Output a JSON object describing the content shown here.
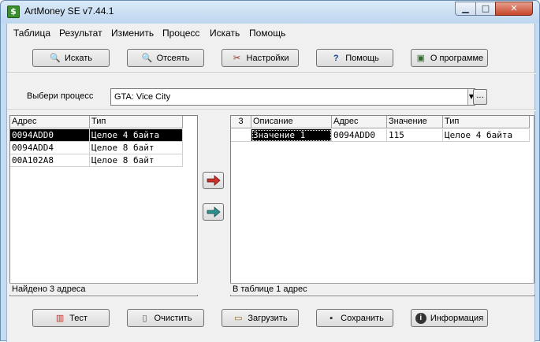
{
  "window": {
    "title": "ArtMoney SE v7.44.1",
    "app_icon": "$"
  },
  "titlebar": {
    "min_icon": "minimize-icon",
    "max_icon": "maximize-icon",
    "close_icon": "close-icon",
    "min_glyph": "▁",
    "max_glyph": "□",
    "close_glyph": "✕"
  },
  "menu": [
    "Таблица",
    "Результат",
    "Изменить",
    "Процесс",
    "Искать",
    "Помощь"
  ],
  "toolbar": [
    {
      "label": "Искать",
      "icon": "magnifier-icon",
      "glyph": "🔍"
    },
    {
      "label": "Отсеять",
      "icon": "magnifier-filter-icon",
      "glyph": "🔍"
    },
    {
      "label": "Настройки",
      "icon": "settings-tools-icon",
      "glyph": "✂"
    },
    {
      "label": "Помощь",
      "icon": "help-icon",
      "glyph": "?"
    },
    {
      "label": "О программе",
      "icon": "about-icon",
      "glyph": "▣"
    }
  ],
  "process": {
    "label": "Выбери процесс",
    "value": "GTA: Vice City",
    "browse": "..."
  },
  "left_table": {
    "headers": [
      "Адрес",
      "Тип"
    ],
    "rows": [
      [
        "0094ADD0",
        "Целое 4 байта"
      ],
      [
        "0094ADD4",
        "Целое 8 байт"
      ],
      [
        "00A102A8",
        "Целое 8 байт"
      ]
    ],
    "status": "Найдено 3 адреса"
  },
  "right_table": {
    "headers": [
      "3",
      "Описание",
      "Адрес",
      "Значение",
      "Тип"
    ],
    "rows": [
      [
        "",
        "Значение 1",
        "0094ADD0",
        "115",
        "Целое 4 байта"
      ]
    ],
    "status": "В таблице 1 адрес"
  },
  "transfer": {
    "add_icon": "arrow-right-red-icon",
    "add_all_icon": "arrow-right-teal-icon",
    "add_color": "#c8342a",
    "add_all_color": "#2f8f8c"
  },
  "bottom_buttons": [
    {
      "label": "Тест",
      "icon": "bar-chart-icon",
      "glyph": "▥"
    },
    {
      "label": "Очистить",
      "icon": "page-icon",
      "glyph": "▯"
    },
    {
      "label": "Загрузить",
      "icon": "folder-open-icon",
      "glyph": "▭"
    },
    {
      "label": "Сохранить",
      "icon": "floppy-disk-icon",
      "glyph": "▪"
    },
    {
      "label": "Информация",
      "icon": "info-icon",
      "glyph": "i"
    }
  ]
}
